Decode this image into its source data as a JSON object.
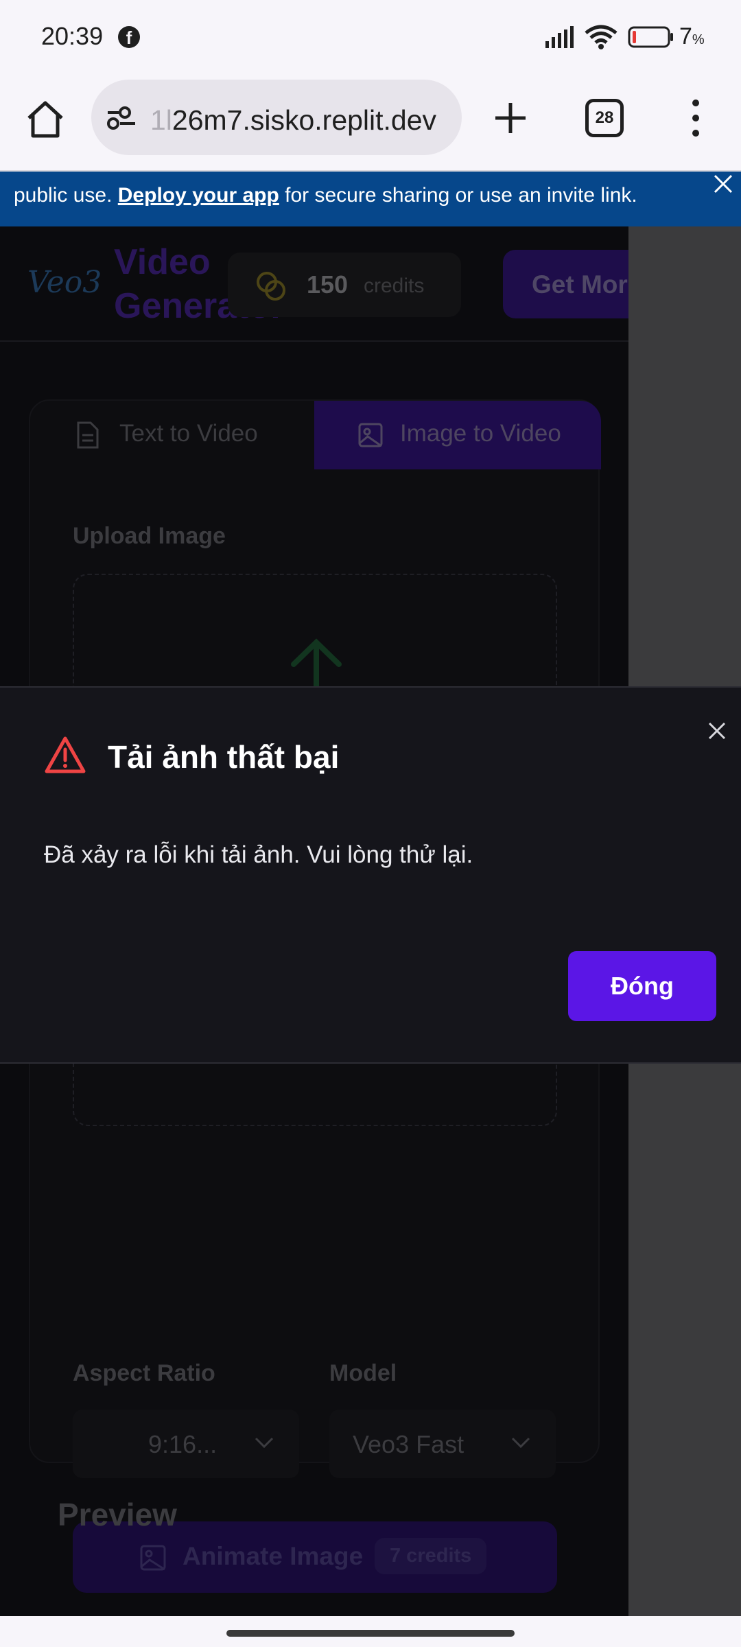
{
  "status_bar": {
    "time": "20:39",
    "battery_percent": "7",
    "battery_unit": "%",
    "icons": [
      "facebook-icon",
      "signal-icon",
      "wifi-icon",
      "battery-low-icon"
    ]
  },
  "browser": {
    "url_faded": "1l",
    "url_main": "26m7.sisko.replit.dev",
    "tab_count": "28"
  },
  "banner": {
    "text_before_link": "public use. ",
    "link_text": "Deploy your app",
    "text_after_link": " for secure sharing or use an invite link."
  },
  "app": {
    "logo_text": "Veo3",
    "title": "Video Generator",
    "credits_value": "150",
    "credits_unit": "credits",
    "get_credits_label": "Get More Credits",
    "tabs": [
      {
        "label": "Text to Video",
        "active": false
      },
      {
        "label": "Image to Video",
        "active": true
      }
    ],
    "upload_label": "Upload Image",
    "aspect_ratio_label": "Aspect Ratio",
    "aspect_ratio_value": "9:16...",
    "model_label": "Model",
    "model_value": "Veo3 Fast",
    "animate_label": "Animate Image",
    "animate_cost": "7 credits",
    "preview_label": "Preview"
  },
  "dialog": {
    "title": "Tải ảnh thất bại",
    "message": "Đã xảy ra lỗi khi tải ảnh. Vui lòng thử lại.",
    "action_label": "Đóng"
  },
  "colors": {
    "dialog_bg": "#15151b",
    "primary": "#5b16e6",
    "warning": "#ef4444",
    "banner_bg": "#06478b"
  }
}
